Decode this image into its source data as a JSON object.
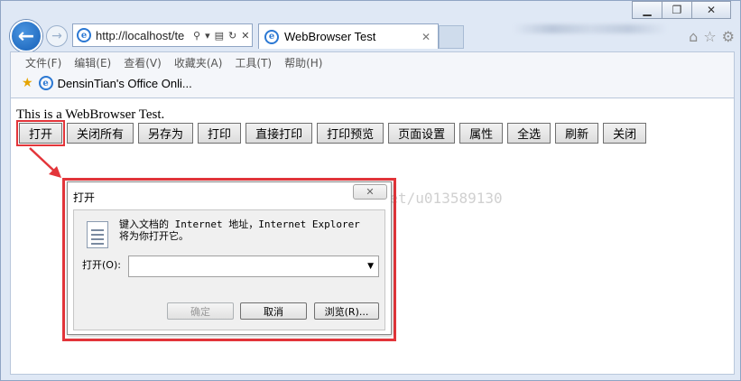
{
  "browser": {
    "url": "http://localhost/te",
    "tab_title": "WebBrowser Test",
    "menu": [
      "文件(F)",
      "编辑(E)",
      "查看(V)",
      "收藏夹(A)",
      "工具(T)",
      "帮助(H)"
    ],
    "favorite": "DensinTian's Office Onli..."
  },
  "page": {
    "text": "This is a WebBrowser Test.",
    "buttons": [
      "打开",
      "关闭所有",
      "另存为",
      "打印",
      "直接打印",
      "打印预览",
      "页面设置",
      "属性",
      "全选",
      "刷新",
      "关闭"
    ]
  },
  "dialog": {
    "title": "打开",
    "message": "键入文档的 Internet 地址，Internet Explorer\n将为你打开它。",
    "label": "打开(O):",
    "input_value": "",
    "ok": "确定",
    "cancel": "取消",
    "browse": "浏览(R)..."
  },
  "watermark": "http://blog.csdn.net/u013589130",
  "colors": {
    "highlight": "#e3353a",
    "ie_blue": "#1660b8"
  }
}
